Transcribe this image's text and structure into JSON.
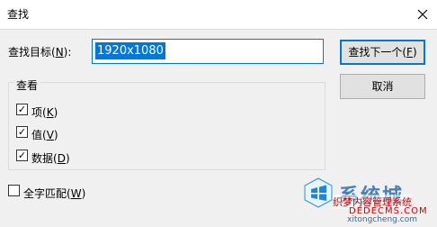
{
  "window": {
    "title": "查找"
  },
  "find": {
    "label_prefix": "查找目标(",
    "label_mnemonic": "N",
    "label_suffix": "):",
    "value": "1920x1080"
  },
  "buttons": {
    "find_next_prefix": "查找下一个(",
    "find_next_mnemonic": "F",
    "find_next_suffix": ")",
    "cancel": "取消"
  },
  "look_in": {
    "title": "查看",
    "options": [
      {
        "prefix": "项(",
        "mnemonic": "K",
        "suffix": ")",
        "checked": true
      },
      {
        "prefix": "值(",
        "mnemonic": "V",
        "suffix": ")",
        "checked": true
      },
      {
        "prefix": "数据(",
        "mnemonic": "D",
        "suffix": ")",
        "checked": true
      }
    ]
  },
  "whole_string": {
    "prefix": "全字匹配(",
    "mnemonic": "W",
    "suffix": ")",
    "checked": false
  },
  "watermark": {
    "brand": "系统城",
    "line1": "织梦内容管理系统",
    "line2": "DEDECMS.COM",
    "line3": "xitongcheng.com"
  },
  "icons": {
    "close": "close-icon",
    "logo": "windows-logo-icon"
  },
  "colors": {
    "accent": "#0078d7",
    "dialog_bg": "#f0f0f0"
  }
}
